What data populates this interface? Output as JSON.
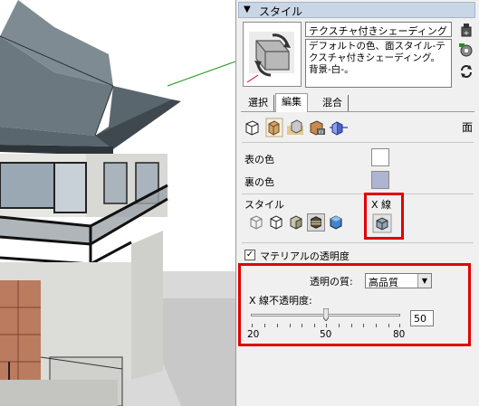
{
  "panel": {
    "title": "スタイル",
    "style_name": "テクスチャ付きシェーディング",
    "style_description": "デフォルトの色、面スタイル-テクスチャ付きシェーディング。背景-白-。"
  },
  "tabs": [
    {
      "label": "選択",
      "active": false
    },
    {
      "label": "編集",
      "active": true
    },
    {
      "label": "混合",
      "active": false
    }
  ],
  "toolbar": {
    "icons": [
      "edge-settings-icon",
      "face-settings-icon",
      "background-settings-icon",
      "watermark-settings-icon",
      "modeling-settings-icon"
    ],
    "right_icon_glyph": "面"
  },
  "face": {
    "front_color_label": "表の色",
    "front_color": "#ffffff",
    "back_color_label": "裏の色",
    "back_color": "#adb5d0"
  },
  "style": {
    "label": "スタイル",
    "xray_label": "X 線",
    "icons": [
      "wireframe-icon",
      "hidden-line-icon",
      "shaded-icon",
      "shaded-textures-icon",
      "monochrome-icon"
    ],
    "selected_icon": "shaded-textures-icon"
  },
  "transparency": {
    "checkbox_label": "マテリアルの透明度",
    "checked": true,
    "quality_label": "透明の質:",
    "quality_value": "高品質",
    "opacity_label": "X 線不透明度:",
    "slider_min_label": "20",
    "slider_mid_label": "50",
    "slider_max_label": "80",
    "slider_value": 50,
    "opacity_value": "50"
  },
  "colors": {
    "highlight_red": "#e00000",
    "titlebar_bg": "#c9d6e6"
  }
}
